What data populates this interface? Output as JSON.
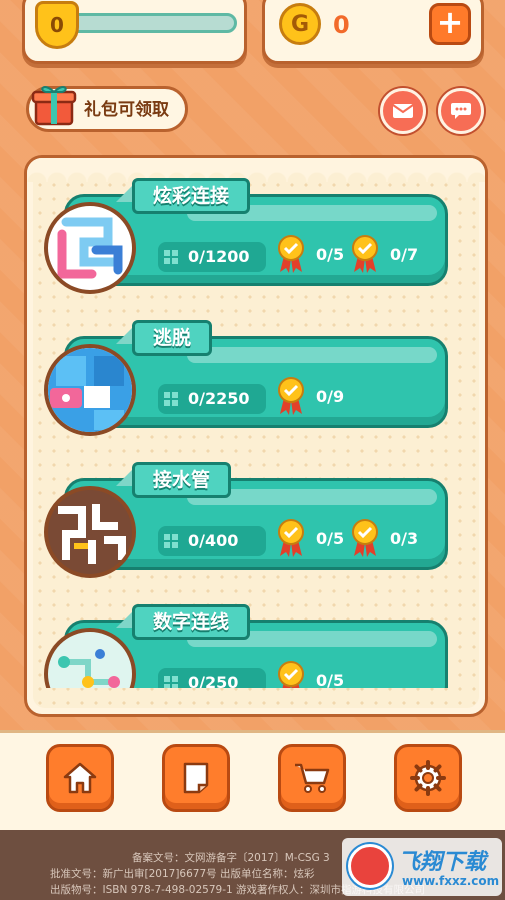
{
  "top": {
    "level_badge": "0",
    "coins": "0",
    "plus_label": "+"
  },
  "gift": {
    "label": "礼包可领取"
  },
  "levels": [
    {
      "title": "炫彩连接",
      "progress": "0/1200",
      "medals": [
        "0/5",
        "0/7"
      ]
    },
    {
      "title": "逃脱",
      "progress": "0/2250",
      "medals": [
        "0/9"
      ]
    },
    {
      "title": "接水管",
      "progress": "0/400",
      "medals": [
        "0/5",
        "0/3"
      ]
    },
    {
      "title": "数字连线",
      "progress": "0/250",
      "medals": [
        "0/5"
      ]
    }
  ],
  "nav": [
    "home-icon",
    "notes-icon",
    "cart-icon",
    "settings-icon"
  ],
  "footer": {
    "line1": "备案文号：文网游备字〔2017〕M-CSG 3",
    "line2": "批准文号：新广出审[2017]6677号   出版单位名称：炫彩",
    "line3": "出版物号：ISBN 978-7-498-02579-1   游戏著作权人：深圳市指游科技有限公司"
  },
  "watermark": {
    "title": "飞翔下载",
    "url": "www.fxxz.com"
  },
  "colors": {
    "accent": "#ff7d2c",
    "card": "#2fc4ad",
    "background": "#f2a167"
  }
}
